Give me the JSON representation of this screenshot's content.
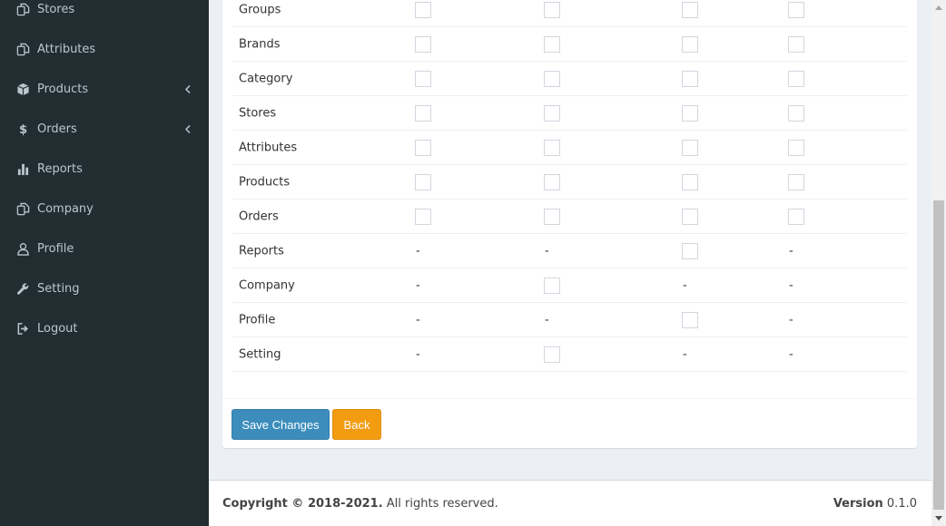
{
  "sidebar": {
    "items": [
      {
        "label": "Stores",
        "icon": "copy-icon",
        "has_chevron": false
      },
      {
        "label": "Attributes",
        "icon": "copy-icon",
        "has_chevron": false
      },
      {
        "label": "Products",
        "icon": "cube-icon",
        "has_chevron": true
      },
      {
        "label": "Orders",
        "icon": "dollar-icon",
        "has_chevron": true
      },
      {
        "label": "Reports",
        "icon": "bar-chart-icon",
        "has_chevron": false
      },
      {
        "label": "Company",
        "icon": "copy-icon",
        "has_chevron": false
      },
      {
        "label": "Profile",
        "icon": "user-icon",
        "has_chevron": false
      },
      {
        "label": "Setting",
        "icon": "wrench-icon",
        "has_chevron": false
      },
      {
        "label": "Logout",
        "icon": "sign-out-icon",
        "has_chevron": false
      }
    ]
  },
  "permissions": {
    "rows": [
      {
        "name": "Groups",
        "cells": [
          "checkbox",
          "checkbox",
          "checkbox",
          "checkbox"
        ]
      },
      {
        "name": "Brands",
        "cells": [
          "checkbox",
          "checkbox",
          "checkbox",
          "checkbox"
        ]
      },
      {
        "name": "Category",
        "cells": [
          "checkbox",
          "checkbox",
          "checkbox",
          "checkbox"
        ]
      },
      {
        "name": "Stores",
        "cells": [
          "checkbox",
          "checkbox",
          "checkbox",
          "checkbox"
        ]
      },
      {
        "name": "Attributes",
        "cells": [
          "checkbox",
          "checkbox",
          "checkbox",
          "checkbox"
        ]
      },
      {
        "name": "Products",
        "cells": [
          "checkbox",
          "checkbox",
          "checkbox",
          "checkbox"
        ]
      },
      {
        "name": "Orders",
        "cells": [
          "checkbox",
          "checkbox",
          "checkbox",
          "checkbox"
        ]
      },
      {
        "name": "Reports",
        "cells": [
          "-",
          "-",
          "checkbox",
          "-"
        ]
      },
      {
        "name": "Company",
        "cells": [
          "-",
          "checkbox",
          "-",
          "-"
        ]
      },
      {
        "name": "Profile",
        "cells": [
          "-",
          "-",
          "checkbox",
          "-"
        ]
      },
      {
        "name": "Setting",
        "cells": [
          "-",
          "checkbox",
          "-",
          "-"
        ]
      }
    ]
  },
  "actions": {
    "save_label": "Save Changes",
    "back_label": "Back"
  },
  "footer": {
    "copyright_bold": "Copyright © 2018-2021.",
    "copyright_rest": " All rights reserved.",
    "version_label": "Version",
    "version_value": " 0.1.0"
  },
  "colors": {
    "sidebar_bg": "#222d32",
    "sidebar_text": "#b8c7ce",
    "primary": "#3c8dbc",
    "warning": "#f39c12",
    "content_bg": "#ecf0f5"
  }
}
